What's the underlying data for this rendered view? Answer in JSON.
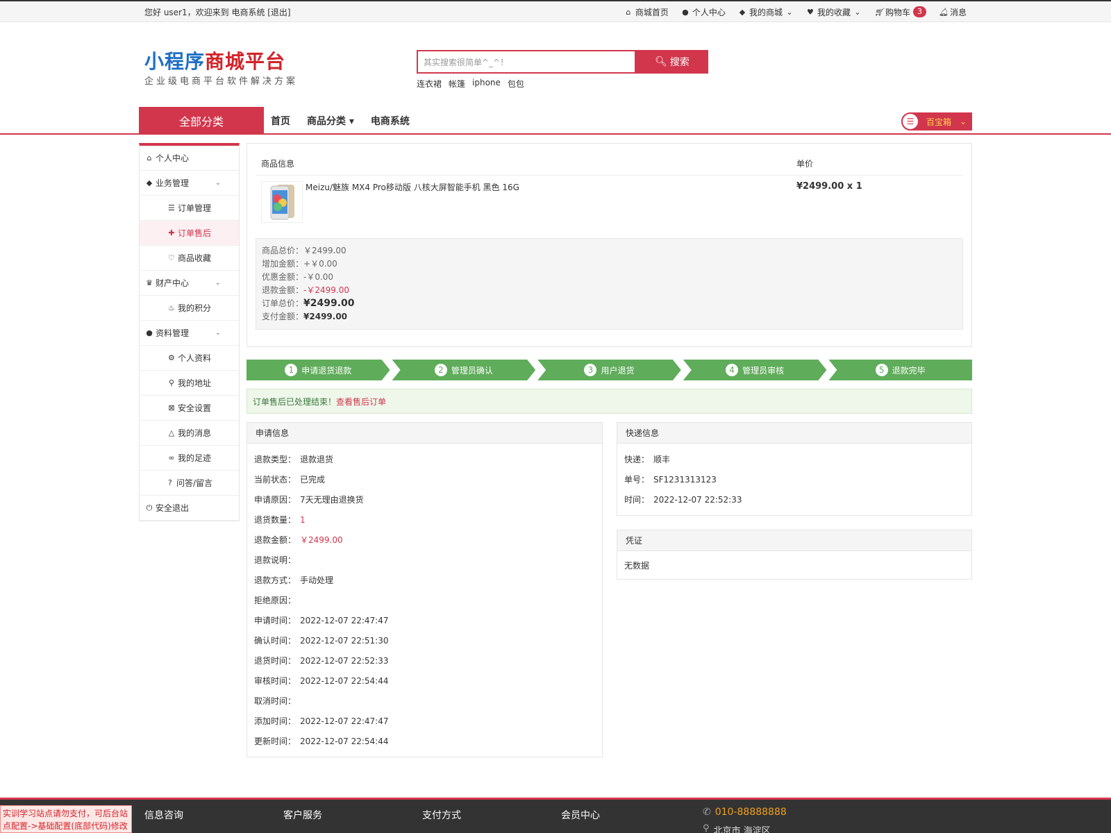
{
  "topbar": {
    "greeting": "您好 user1，欢迎来到 电商系统 [退出]",
    "links": {
      "home": "商城首页",
      "ucenter": "个人中心",
      "myshop": "我的商城",
      "fav": "我的收藏",
      "cart": "购物车",
      "cart_count": "3",
      "msg": "消息"
    }
  },
  "logo": {
    "part1": "小程序",
    "part2": "商城平台",
    "tagline": "企业级电商平台软件解决方案"
  },
  "search": {
    "placeholder": "其实搜索很简单^_^！",
    "button": "搜索",
    "hotwords": [
      "连衣裙",
      "帐篷",
      "iphone",
      "包包"
    ]
  },
  "nav": {
    "all_categories": "全部分类",
    "links": [
      "首页",
      "商品分类",
      "电商系统"
    ],
    "treasure_box": "百宝箱"
  },
  "sidebar": {
    "items": [
      {
        "label": "个人中心",
        "icon": "home-icon",
        "sub": false
      },
      {
        "label": "业务管理",
        "icon": "cube-icon",
        "sub": false,
        "expand": true
      },
      {
        "label": "订单管理",
        "icon": "list-icon",
        "sub": true
      },
      {
        "label": "订单售后",
        "icon": "puzzle-icon",
        "sub": true,
        "active": true
      },
      {
        "label": "商品收藏",
        "icon": "heart-icon",
        "sub": true
      },
      {
        "label": "财产中心",
        "icon": "trophy-icon",
        "sub": false,
        "expand": true
      },
      {
        "label": "我的积分",
        "icon": "fire-icon",
        "sub": true
      },
      {
        "label": "资料管理",
        "icon": "user-icon",
        "sub": false,
        "expand": true
      },
      {
        "label": "个人资料",
        "icon": "gear-icon",
        "sub": true
      },
      {
        "label": "我的地址",
        "icon": "location-icon",
        "sub": true
      },
      {
        "label": "安全设置",
        "icon": "lock-icon",
        "sub": true
      },
      {
        "label": "我的消息",
        "icon": "bell-icon",
        "sub": true
      },
      {
        "label": "我的足迹",
        "icon": "footprint-icon",
        "sub": true
      },
      {
        "label": "问答/留言",
        "icon": "question-icon",
        "sub": true
      },
      {
        "label": "安全退出",
        "icon": "power-icon",
        "sub": false
      }
    ]
  },
  "order": {
    "header_info": "商品信息",
    "header_price": "单价",
    "product_title": "Meizu/魅族 MX4 Pro移动版 八核大屏智能手机 黑色 16G",
    "product_price": "¥2499.00 x 1",
    "summary": {
      "goods_total": {
        "label": "商品总价：",
        "value": "￥2499.00"
      },
      "add_amount": {
        "label": "增加金额：",
        "value": "+￥0.00"
      },
      "discount": {
        "label": "优惠金额：",
        "value": "-￥0.00"
      },
      "refund": {
        "label": "退款金额：",
        "value": "-￥2499.00"
      },
      "order_total": {
        "label": "订单总价：",
        "value": "¥2499.00"
      },
      "paid": {
        "label": "支付金额：",
        "value": "¥2499.00"
      }
    }
  },
  "steps": [
    {
      "num": "1",
      "label": "申请退货退款"
    },
    {
      "num": "2",
      "label": "管理员确认"
    },
    {
      "num": "3",
      "label": "用户退货"
    },
    {
      "num": "4",
      "label": "管理员审核"
    },
    {
      "num": "5",
      "label": "退款完毕"
    }
  ],
  "notice": {
    "text": "订单售后已处理结束！",
    "link": "查看售后订单"
  },
  "apply": {
    "title": "申请信息",
    "rows": [
      {
        "k": "退款类型：",
        "v": "退款退货"
      },
      {
        "k": "当前状态：",
        "v": "已完成"
      },
      {
        "k": "申请原因：",
        "v": "7天无理由退换货"
      },
      {
        "k": "退货数量：",
        "v": "1",
        "red": true
      },
      {
        "k": "退款金额：",
        "v": "￥2499.00",
        "red": true
      },
      {
        "k": "退款说明：",
        "v": ""
      },
      {
        "k": "退款方式：",
        "v": "手动处理"
      },
      {
        "k": "拒绝原因：",
        "v": ""
      },
      {
        "k": "申请时间：",
        "v": "2022-12-07 22:47:47"
      },
      {
        "k": "确认时间：",
        "v": "2022-12-07 22:51:30"
      },
      {
        "k": "退货时间：",
        "v": "2022-12-07 22:52:33"
      },
      {
        "k": "审核时间：",
        "v": "2022-12-07 22:54:44"
      },
      {
        "k": "取消时间：",
        "v": ""
      },
      {
        "k": "添加时间：",
        "v": "2022-12-07 22:47:47"
      },
      {
        "k": "更新时间：",
        "v": "2022-12-07 22:54:44"
      }
    ]
  },
  "express": {
    "title": "快递信息",
    "rows": [
      {
        "k": "快递：",
        "v": "顺丰"
      },
      {
        "k": "单号：",
        "v": "SF1231313123"
      },
      {
        "k": "时间：",
        "v": "2022-12-07 22:52:33"
      }
    ]
  },
  "voucher": {
    "title": "凭证",
    "empty": "无数据"
  },
  "footer": {
    "cols": [
      "信息咨询",
      "客户服务",
      "支付方式",
      "会员中心"
    ],
    "phone": "010-88888888",
    "address": "北京市 海淀区",
    "dev_note": "实训学习站点请勿支付，可后台站点配置->基础配置(底部代码)修改"
  },
  "colors": {
    "brand": "#d2364c",
    "step_green": "#5fac5a",
    "logo_blue": "#1e6ec5"
  }
}
